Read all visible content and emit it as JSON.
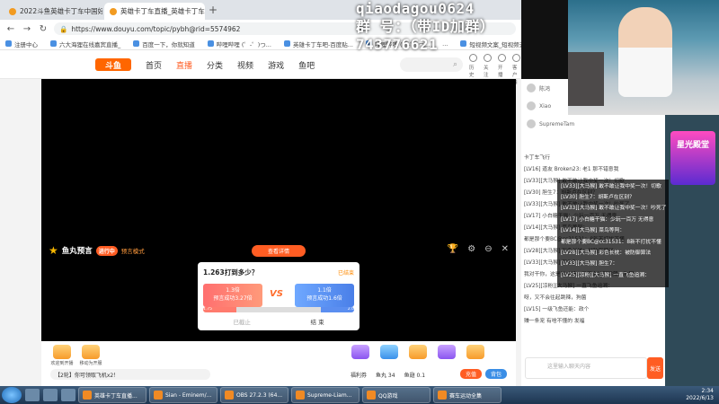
{
  "tabs": [
    {
      "title": "2022斗鱼英雄卡丁车中国好司机",
      "active": false
    },
    {
      "title": "英雄卡丁车直播_英雄卡丁车直...",
      "active": true
    }
  ],
  "address": {
    "url": "https://www.douyu.com/topic/pybh@rid=5574962"
  },
  "bookmarks": [
    "注册中心",
    "六大海狸在线嘉宾直播_",
    "百度一下，你就知道",
    "哔哩哔哩 (゜-゜)つ...",
    "英雄卡丁车吧-百度贴...",
    "哔哩哔哩 (゜-゜)つ...",
    "...",
    "短视频文案_短视频去重..."
  ],
  "site": {
    "logo": "斗鱼",
    "nav": [
      "首页",
      "直播",
      "分类",
      "视频",
      "游戏",
      "鱼吧"
    ],
    "nav_active": "直播",
    "header_icons": [
      "历史",
      "关注",
      "开播",
      "客户端",
      "消息",
      "任务"
    ]
  },
  "player": {
    "preview_title": "鱼丸预言",
    "preview_badge": "进行中",
    "preview_mode": "预言模式",
    "pill": "查看详情"
  },
  "predict": {
    "question": "1.263打到多少？",
    "link": "已结束",
    "option_a": {
      "rate": "1.3倍",
      "text": "预言成功3.27倍"
    },
    "option_b": {
      "rate": "1.1倍",
      "text": "预言成功1.6倍"
    },
    "vs": "VS",
    "bar_left": "1.75",
    "bar_right": "2.0",
    "footer_left": "已截止",
    "footer_right": "结 束"
  },
  "giftbar": {
    "notice": "【2轮】你可领取飞机x2！",
    "items": [
      "欢迎到开播",
      "移动为开服"
    ],
    "meta_left": "福利券",
    "meta_right": "鱼丸 34",
    "meta_extra": "鱼翅 0.1",
    "btn_recharge": "充值",
    "btn_bag": "背包"
  },
  "chat": {
    "ranks": [
      "陈鸿",
      "Xiao",
      "SupremeTam"
    ],
    "input_placeholder": "这里输入聊天内容",
    "send": "发送",
    "msgs": [
      "卡丁车飞行",
      "[LV16] 道友  Broken23: 老1 那不错意我",
      "[LV33][大马猴] 敢不敢让我中奖一次！切歌",
      "[LV30] 胆生7：胡斯卢在区别？",
      "[LV33][大马猴] 敢不敢让我中奖一次！吵死了",
      "[LV17] 小白糖干猫：少玩一百万 无得意",
      "[LV14][大马猴] 菜鸟等阿：",
      "都是那个要BC@cc31531：8新不打扰不懂",
      "[LV28][大马猴] 彩色长枕：被防御算法",
      "[LV33][大马猴] 胆生7：",
      "我对干你，这是NbA场，又不会往起跳辣，狗服",
      "[LV25][凉粉][大马猴] 一直飞鱼追溯：",
      "呀，又不会往起跳辣，狗菌",
      "[LV15]   一级飞鱼还能：政个",
      "赚一条宠  有啥不懂的 发福"
    ]
  },
  "overlay": {
    "lines": [
      "qiaodagou0624",
      "群  号：（带ID加群）",
      "743776621"
    ],
    "promo": "星光殿堂"
  },
  "taskbar": {
    "tasks": [
      "英雄卡丁车直播...",
      "Sian - Eminem/...",
      "OBS 27.2.3 (64...",
      "Supreme-Liam...",
      "QQ游戏",
      "赛车运动全集"
    ],
    "time": "2:34",
    "date": "2022/6/13"
  }
}
